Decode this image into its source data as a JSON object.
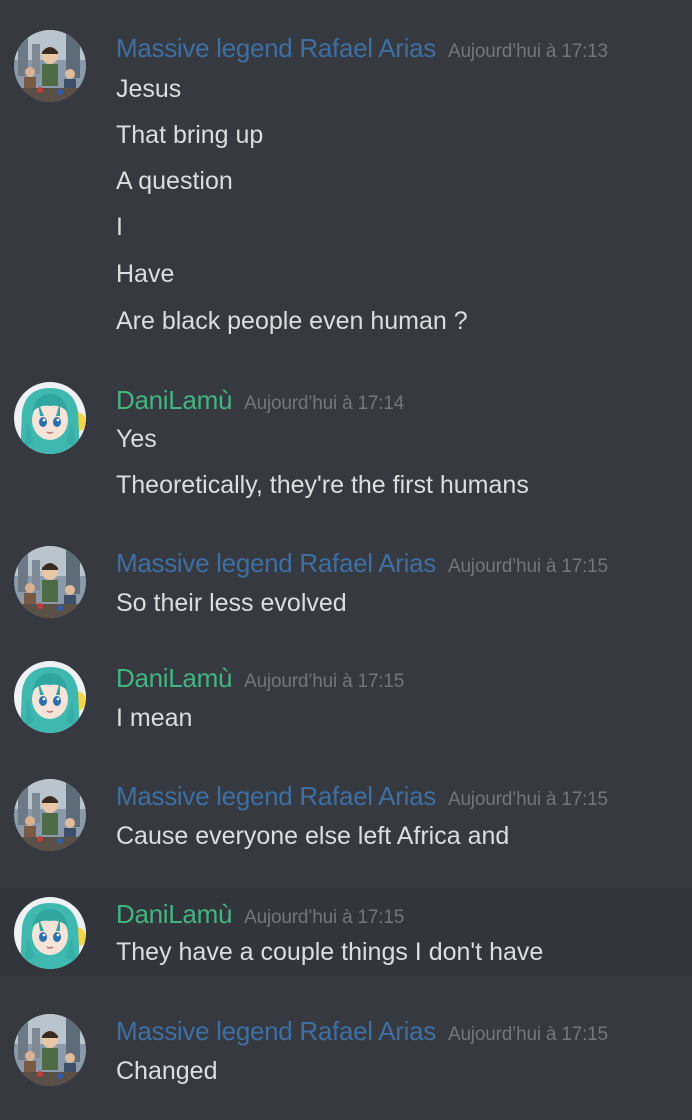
{
  "colors": {
    "background": "#36393f",
    "hover_background": "#32353b",
    "message_text": "#dcddde",
    "timestamp": "#72767d",
    "rafael_name": "#3e6fa3",
    "dani_name": "#43b581"
  },
  "messages": [
    {
      "author": "Massive legend Rafael Arias",
      "timestamp": "Aujourd’hui à 17:13",
      "avatar_icon": "anime-group-avatar-icon",
      "lines": [
        "Jesus",
        "That bring up",
        "A question",
        "I",
        "Have",
        "Are black people even human ?"
      ]
    },
    {
      "author": "DaniLamù",
      "timestamp": "Aujourd’hui à 17:14",
      "avatar_icon": "anime-girl-avatar-icon",
      "lines": [
        "Yes",
        "Theoretically, they're the first humans"
      ]
    },
    {
      "author": "Massive legend Rafael Arias",
      "timestamp": "Aujourd’hui à 17:15",
      "avatar_icon": "anime-group-avatar-icon",
      "lines": [
        "So their less evolved"
      ]
    },
    {
      "author": "DaniLamù",
      "timestamp": "Aujourd’hui à 17:15",
      "avatar_icon": "anime-girl-avatar-icon",
      "lines": [
        "I mean"
      ]
    },
    {
      "author": "Massive legend Rafael Arias",
      "timestamp": "Aujourd’hui à 17:15",
      "avatar_icon": "anime-group-avatar-icon",
      "lines": [
        "Cause everyone else left Africa and"
      ]
    },
    {
      "author": "DaniLamù",
      "timestamp": "Aujourd’hui à 17:15",
      "avatar_icon": "anime-girl-avatar-icon",
      "lines": [
        "They have a couple things I don't have"
      ]
    },
    {
      "author": "Massive legend Rafael Arias",
      "timestamp": "Aujourd’hui à 17:15",
      "avatar_icon": "anime-group-avatar-icon",
      "lines": [
        "Changed"
      ]
    }
  ]
}
